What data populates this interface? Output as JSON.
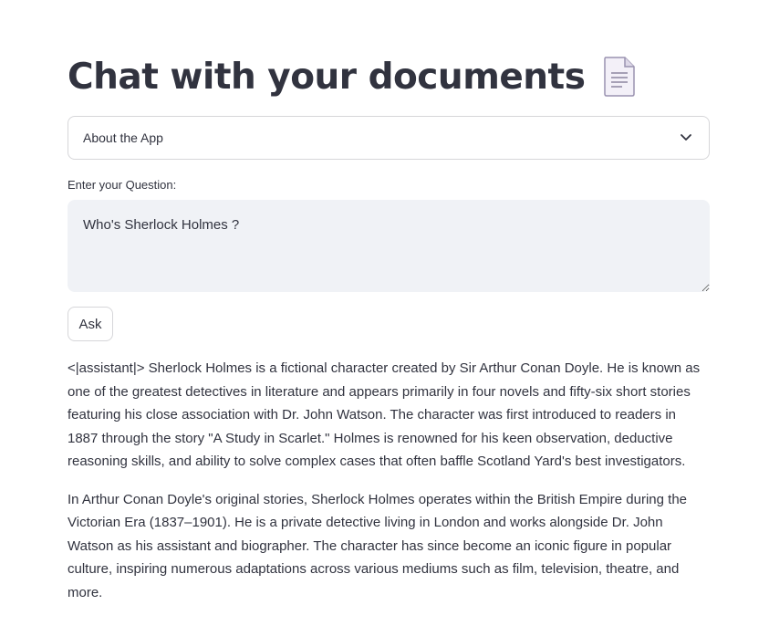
{
  "page": {
    "title": "Chat with your documents",
    "title_icon": "document-icon"
  },
  "expander": {
    "label": "About the App",
    "icon": "chevron-down-icon"
  },
  "question": {
    "label": "Enter your Question:",
    "value": "Who's Sherlock Holmes ?"
  },
  "ask_button": {
    "label": "Ask"
  },
  "answer": {
    "paragraphs": [
      "<|assistant|> Sherlock Holmes is a fictional character created by Sir Arthur Conan Doyle. He is known as one of the greatest detectives in literature and appears primarily in four novels and fifty-six short stories featuring his close association with Dr. John Watson. The character was first introduced to readers in 1887 through the story \"A Study in Scarlet.\" Holmes is renowned for his keen observation, deductive reasoning skills, and ability to solve complex cases that often baffle Scotland Yard's best investigators.",
      "In Arthur Conan Doyle's original stories, Sherlock Holmes operates within the British Empire during the Victorian Era (1837–1901). He is a private detective living in London and works alongside Dr. John Watson as his assistant and biographer. The character has since become an iconic figure in popular culture, inspiring numerous adaptations across various mediums such as film, television, theatre, and more."
    ]
  },
  "colors": {
    "text": "#31333f",
    "input_background": "#f0f2f6",
    "border": "#d6d6d9"
  }
}
